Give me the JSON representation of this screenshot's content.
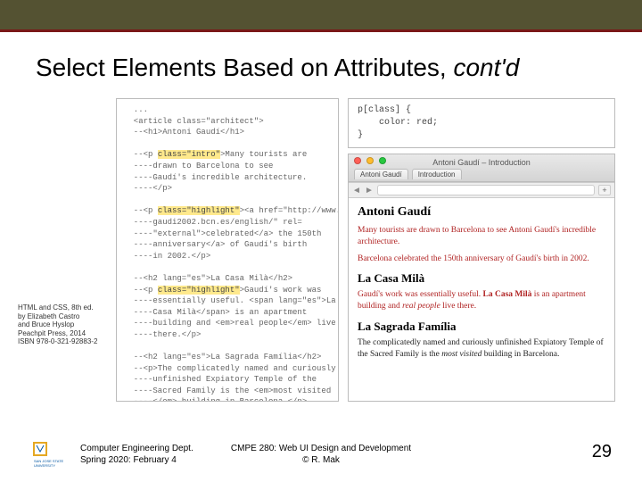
{
  "header": {
    "title_main": "Select Elements Based on Attributes, ",
    "title_contd": "cont'd"
  },
  "code_html": "  ...\n  <article class=\"architect\">\n  --<h1>Antoni Gaudí</h1>\n\n  --<p [HL]class=\"intro\"[/HL]>Many tourists are\n  ----drawn to Barcelona to see\n  ----Gaudí's incredible architecture.\n  ----</p>\n\n  --<p [HL]class=\"highlight\"[/HL]><a href=\"http://www.\n  ----gaudi2002.bcn.es/english/\" rel=\n  ----\"external\">celebrated</a> the 150th\n  ----anniversary</a> of Gaudí's birth\n  ----in 2002.</p>\n\n  --<h2 lang=\"es\">La Casa Milà</h2>\n  --<p [HL]class=\"highlight\"[/HL]>Gaudí's work was\n  ----essentially useful. <span lang=\"es\">La\n  ----Casa Milà</span> is an apartment\n  ----building and <em>real people</em> live\n  ----there.</p>\n\n  --<h2 lang=\"es\">La Sagrada Família</h2>\n  --<p>The complicatedly named and curiously\n  ----unfinished Expiatory Temple of the\n  ----Sacred Family is the <em>most visited\n  ----</em> building in Barcelona.</p>\n  </article>\n  ...",
  "code_css": "p[class] {\n    color: red;\n}",
  "browser": {
    "window_title": "Antoni Gaudí – Introduction",
    "tab1": "Antoni Gaudí",
    "tab2": "Introduction",
    "plus": "+",
    "h1": "Antoni Gaudí",
    "p1a": "Many tourists are drawn to Barcelona to see Antoni Gaudí's incredible architecture.",
    "p2a": "Barcelona ",
    "p2b": "celebrated",
    "p2c": " the 150th anniversary of Gaudí's birth in 2002.",
    "h2a": "La Casa Milà",
    "p3a": "Gaudí's work was essentially useful. ",
    "p3b": "La Casa Milà",
    "p3c": " is an apartment building and ",
    "p3d": "real people",
    "p3e": " live there.",
    "h2b": "La Sagrada Família",
    "p4a": "The complicatedly named and curiously unfinished Expiatory Temple of the Sacred Family is the ",
    "p4b": "most visited",
    "p4c": " building in Barcelona."
  },
  "credits": {
    "l1": "HTML and CSS, 8th ed.",
    "l2": "by Elizabeth Castro",
    "l3": "and Bruce Hyslop",
    "l4": "Peachpit Press, 2014",
    "l5": "ISBN 978-0-321-92883-2"
  },
  "footer": {
    "left1": "Computer Engineering Dept.",
    "left2": "Spring 2020: February 4",
    "center1": "CMPE 280: Web UI Design and Development",
    "center2": "© R. Mak",
    "page": "29"
  }
}
